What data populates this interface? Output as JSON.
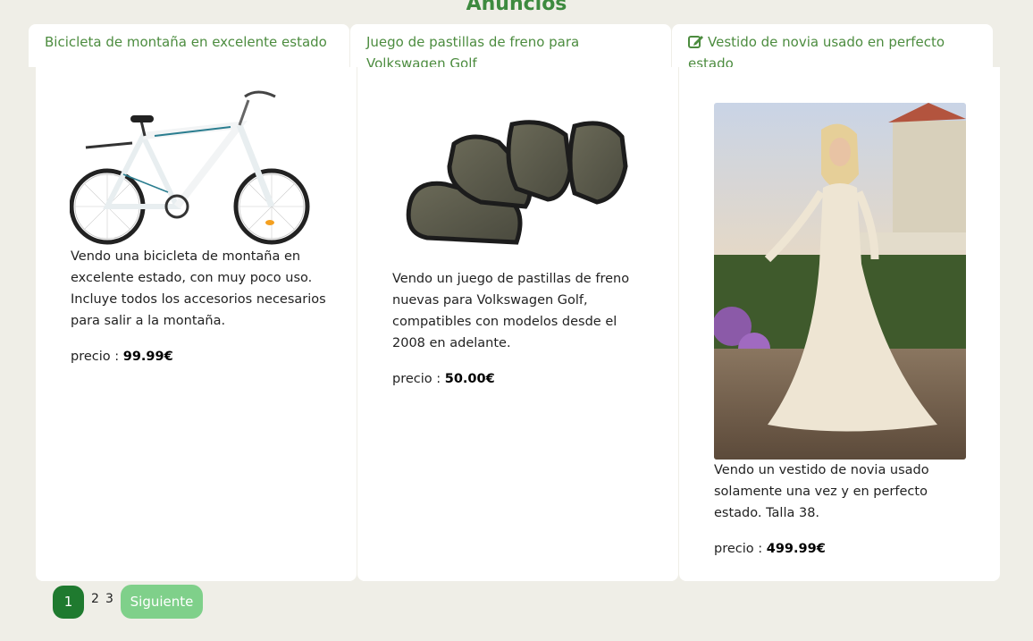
{
  "page": {
    "title": "Anuncios"
  },
  "ads": [
    {
      "title": "Bicicleta de montaña en excelente estado",
      "description": "Vendo una bicicleta de montaña en excelente estado, con muy poco uso. Incluye todos los accesorios necesarios para salir a la montaña.",
      "price_label": "precio :",
      "price": "99.99€",
      "image_alt": "bicycle"
    },
    {
      "title": "Juego de pastillas de freno para Volkswagen Golf",
      "description": "Vendo un juego de pastillas de freno nuevas para Volkswagen Golf, compatibles con modelos desde el 2008 en adelante.",
      "price_label": "precio :",
      "price": "50.00€",
      "image_alt": "brake pads"
    },
    {
      "title": "Vestido de novia usado en perfecto estado",
      "description": "Vendo un vestido de novia usado solamente una vez y en perfecto estado. Talla 38.",
      "price_label": "precio :",
      "price": "499.99€",
      "image_alt": "wedding dress",
      "icon": "edit-icon"
    }
  ],
  "pagination": {
    "current": "1",
    "pages": [
      "2",
      "3"
    ],
    "next_label": "Siguiente"
  },
  "colors": {
    "background": "#efeee7",
    "title_green": "#3d8a3f",
    "header_green": "#4c8c3f",
    "active_page": "#1f7a2f",
    "next_button": "#7fd08a"
  }
}
